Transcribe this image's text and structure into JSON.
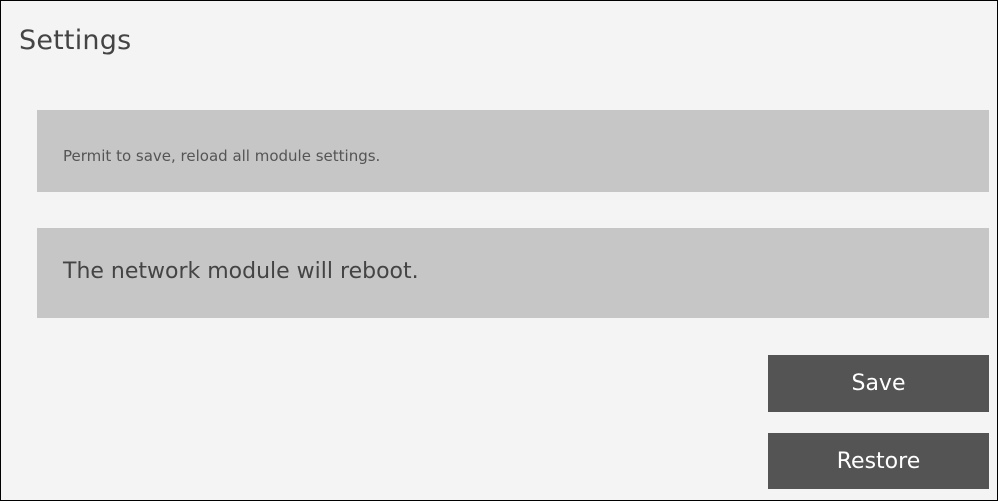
{
  "panel": {
    "title": "Settings"
  },
  "info": {
    "text": "Permit to save, reload all module settings."
  },
  "warning": {
    "text": "The network module will reboot."
  },
  "actions": {
    "save_label": "Save",
    "restore_label": "Restore"
  }
}
